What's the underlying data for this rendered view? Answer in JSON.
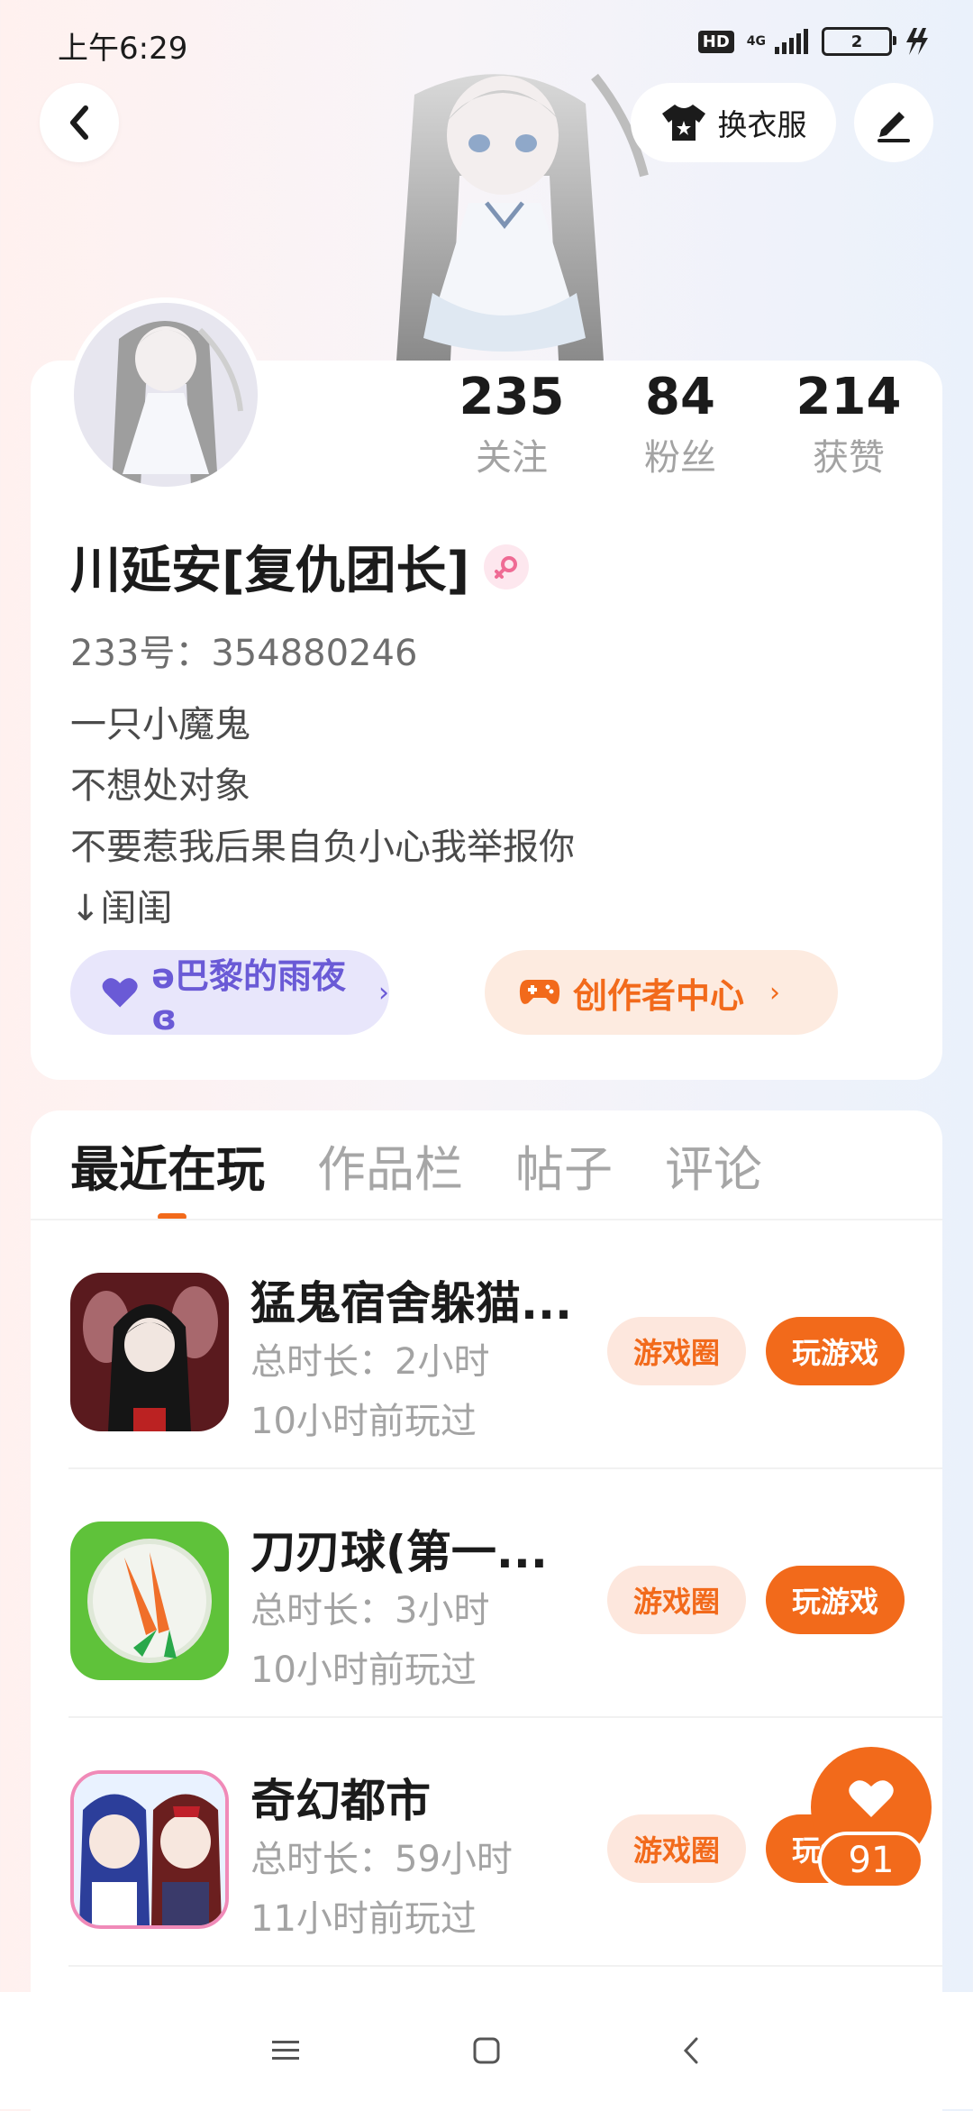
{
  "status_bar": {
    "time": "上午6:29",
    "hd": "HD",
    "network": "4G",
    "battery": "2"
  },
  "header": {
    "outfit_label": "换衣服"
  },
  "profile": {
    "stats": [
      {
        "value": "235",
        "label": "关注"
      },
      {
        "value": "84",
        "label": "粉丝"
      },
      {
        "value": "214",
        "label": "获赞"
      }
    ],
    "nickname": "川延安[复仇团长]",
    "uid": "233号：354880246",
    "bio": [
      "一只小魔鬼",
      "不想处对象",
      "不要惹我后果自负小心我举报你",
      "↓闺闺"
    ],
    "fan_group_label": "ə巴黎的雨夜ɞ",
    "creator_center_label": "创作者中心"
  },
  "tabs": [
    {
      "label": "最近在玩",
      "active": true
    },
    {
      "label": "作品栏"
    },
    {
      "label": "帖子"
    },
    {
      "label": "评论"
    }
  ],
  "games": [
    {
      "title": "猛鬼宿舍躲猫...",
      "duration": "总时长：2小时",
      "last_played": "10小时前玩过",
      "circle_label": "游戏圈",
      "play_label": "玩游戏"
    },
    {
      "title": "刀刃球(第一...",
      "duration": "总时长：3小时",
      "last_played": "10小时前玩过",
      "circle_label": "游戏圈",
      "play_label": "玩游戏"
    },
    {
      "title": "奇幻都市",
      "duration": "总时长：59小时",
      "last_played": "11小时前玩过",
      "circle_label": "游戏圈",
      "play_label": "玩游戏"
    }
  ],
  "like_fab": {
    "count": "91"
  },
  "colors": {
    "accent": "#f26a1b",
    "fan_purple": "#6a5ad6"
  }
}
